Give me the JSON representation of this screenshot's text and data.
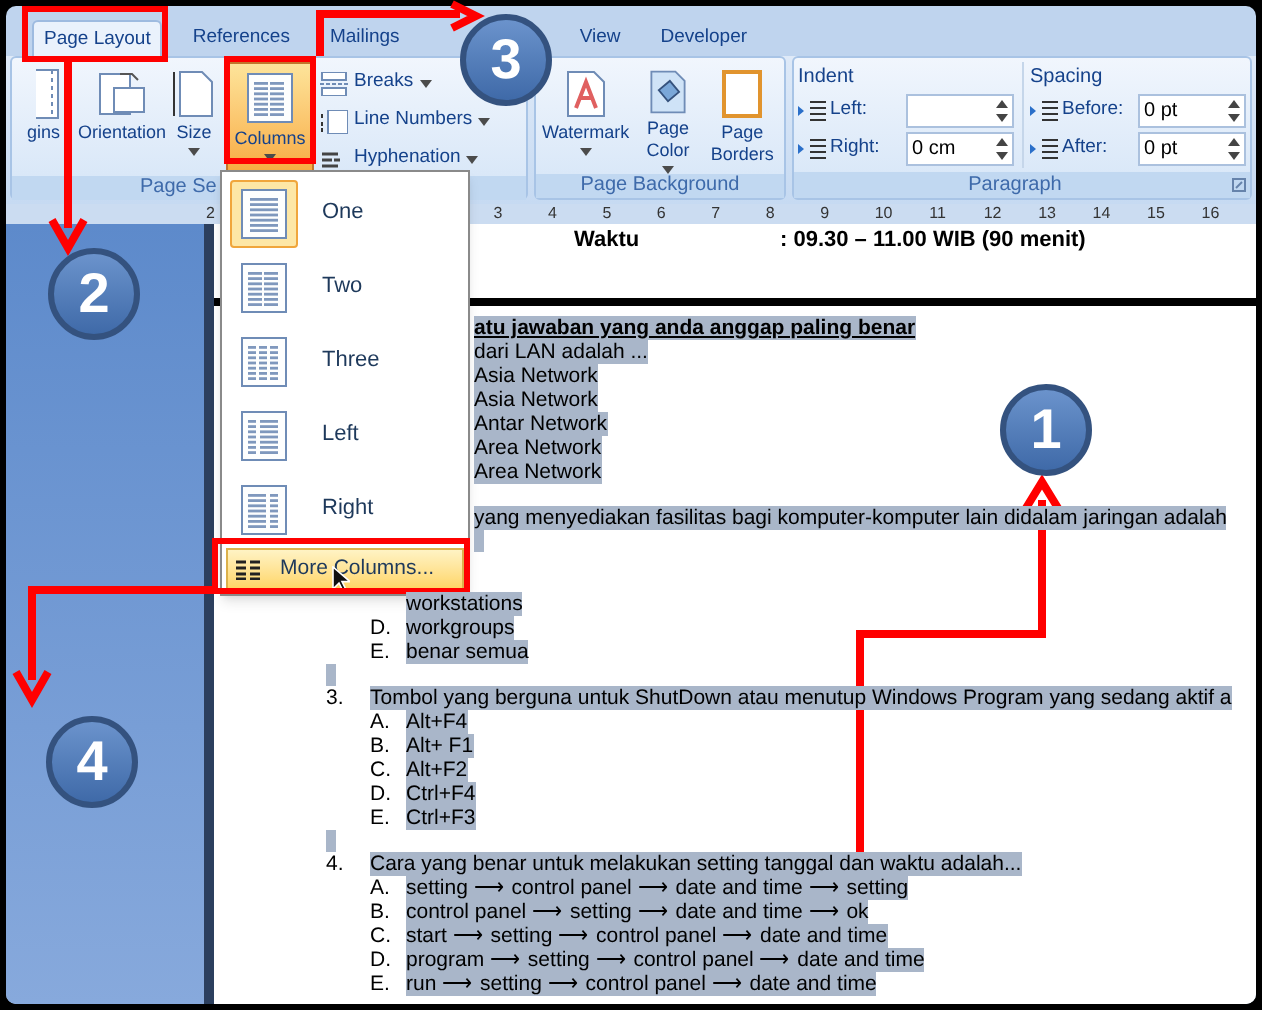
{
  "tabs": [
    {
      "label": "Page Layout",
      "selected": true
    },
    {
      "label": "References",
      "selected": false
    },
    {
      "label": "Mailings",
      "selected": false
    },
    {
      "label": "View",
      "selected": false
    },
    {
      "label": "Developer",
      "selected": false
    }
  ],
  "page_setup": {
    "group_label": "Page Se",
    "large_buttons": [
      {
        "label": "gins",
        "kind": "margins",
        "selected": false,
        "dropdown": false
      },
      {
        "label": "Orientation",
        "kind": "orientation",
        "selected": false,
        "dropdown": false
      },
      {
        "label": "Size",
        "kind": "size",
        "selected": false,
        "dropdown": true
      },
      {
        "label": "Columns",
        "kind": "columns",
        "selected": true,
        "dropdown": true
      }
    ],
    "small_buttons": [
      {
        "label": "Breaks",
        "kind": "breaks"
      },
      {
        "label": "Line Numbers",
        "kind": "line_numbers"
      },
      {
        "label": "Hyphenation",
        "kind": "hyphenation"
      }
    ]
  },
  "page_background": {
    "group_label": "Page Background",
    "buttons": [
      {
        "label": "Watermark",
        "kind": "watermark",
        "dropdown": true
      },
      {
        "label": "Page Color",
        "kind": "page_color",
        "dropdown": true
      },
      {
        "label": "Page Borders",
        "kind": "page_borders",
        "dropdown": false
      }
    ]
  },
  "paragraph": {
    "group_label": "Paragraph",
    "indent": {
      "title": "Indent",
      "fields": [
        {
          "label": "Left:"
        },
        {
          "label": "Right:",
          "value": "0 cm"
        }
      ]
    },
    "spacing": {
      "title": "Spacing",
      "fields": [
        {
          "label": "Before:",
          "value": "0 pt"
        },
        {
          "label": "After:",
          "value": "0 pt"
        }
      ]
    }
  },
  "ruler": {
    "labels": [
      "2",
      "3",
      "4",
      "5",
      "6",
      "7",
      "8",
      "9",
      "10",
      "11",
      "12",
      "13",
      "14",
      "15",
      "16"
    ]
  },
  "columns_menu": {
    "items": [
      {
        "label": "One",
        "kind": "one",
        "selected": true
      },
      {
        "label": "Two",
        "kind": "two",
        "selected": false
      },
      {
        "label": "Three",
        "kind": "three",
        "selected": false
      },
      {
        "label": "Left",
        "kind": "left",
        "selected": false
      },
      {
        "label": "Right",
        "kind": "right",
        "selected": false
      }
    ],
    "more": {
      "label": "More Columns...",
      "highlighted": true
    }
  },
  "document": {
    "header": {
      "label": "Waktu",
      "value": ": 09.30 – 11.00 WIB (90 menit)"
    },
    "lines": [
      {
        "kind": "heading_cut",
        "text": "atu jawaban yang anda anggap paling benar"
      },
      {
        "kind": "cut",
        "text": "dari LAN adalah ..."
      },
      {
        "kind": "cut",
        "text": "Asia Network"
      },
      {
        "kind": "cut",
        "text": "Asia Network"
      },
      {
        "kind": "cut",
        "text": "Antar Network"
      },
      {
        "kind": "cut",
        "text": "Area Network"
      },
      {
        "kind": "cut",
        "text": "Area Network"
      },
      {
        "kind": "question_cut",
        "text": "yang menyediakan fasilitas bagi komputer-komputer lain didalam jaringan adalah"
      },
      {
        "kind": "marker_cut"
      },
      {
        "kind": "option",
        "text": "workstations"
      },
      {
        "kind": "option",
        "letter": "D.",
        "text": "workgroups"
      },
      {
        "kind": "option",
        "letter": "E.",
        "text": "benar semua"
      },
      {
        "kind": "marker"
      },
      {
        "kind": "question",
        "number": "3.",
        "text": "Tombol yang berguna untuk ShutDown atau menutup Windows Program yang sedang aktif a"
      },
      {
        "kind": "option",
        "letter": "A.",
        "text": "Alt+F4"
      },
      {
        "kind": "option",
        "letter": "B.",
        "text": "Alt+ F1"
      },
      {
        "kind": "option",
        "letter": "C.",
        "text": "Alt+F2"
      },
      {
        "kind": "option",
        "letter": "D.",
        "text": "Ctrl+F4"
      },
      {
        "kind": "option",
        "letter": "E.",
        "text": "Ctrl+F3"
      },
      {
        "kind": "marker"
      },
      {
        "kind": "question",
        "number": "4.",
        "text": "Cara yang benar untuk melakukan setting tanggal dan waktu adalah..."
      },
      {
        "kind": "option",
        "letter": "A.",
        "text": "setting ⟶ control panel ⟶ date and time ⟶ setting"
      },
      {
        "kind": "option",
        "letter": "B.",
        "text": "control panel ⟶ setting ⟶ date and time ⟶ ok"
      },
      {
        "kind": "option",
        "letter": "C.",
        "text": "start ⟶ setting ⟶ control panel ⟶ date and time"
      },
      {
        "kind": "option",
        "letter": "D.",
        "text": "program ⟶ setting ⟶ control panel ⟶ date and time"
      },
      {
        "kind": "option",
        "letter": "E.",
        "text": "run ⟶ setting ⟶ control panel ⟶ date and time"
      }
    ]
  },
  "annotations": {
    "markers": [
      "1",
      "2",
      "3",
      "4"
    ]
  }
}
